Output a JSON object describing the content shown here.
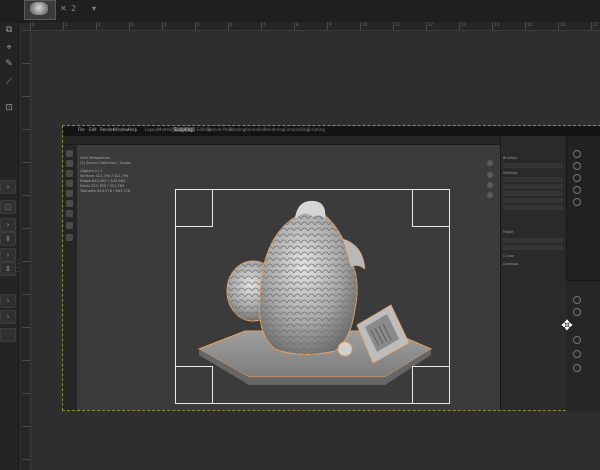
{
  "app": {
    "tab_indicator": "2",
    "accent_selection": "#e8a060",
    "layer_border_color": "#8c8c3c"
  },
  "rulers": {
    "horizontal_ticks": [
      "0",
      "1",
      "2",
      "3",
      "4",
      "5",
      "6",
      "7",
      "8",
      "9",
      "10",
      "11",
      "12",
      "13",
      "14",
      "15",
      "16",
      "17"
    ]
  },
  "toolbox": {
    "tool_icons": [
      "crop-icon",
      "eyedropper-icon",
      "brush-icon",
      "clone-icon",
      "transform-icon"
    ]
  },
  "blender": {
    "menus": [
      "File",
      "Edit",
      "Render",
      "Window",
      "Help"
    ],
    "workspaces": [
      "Layout",
      "Modeling",
      "Sculpting",
      "UV Editing",
      "Texture Paint",
      "Shading",
      "Animation",
      "Rendering",
      "Compositing",
      "Scripting"
    ],
    "active_workspace": "Sculpting",
    "viewport_info": [
      "User Perspective",
      "(1) Scene Collection | Sculpt"
    ],
    "stats": [
      "Objects    0 / 1",
      "Vertices   321,794 / 321,794",
      "Edges      643,582 / 643,582",
      "Faces      321,789 / 321,789",
      "Triangles  643,578 / 643,578"
    ],
    "props_sections": [
      "Brushes",
      "Settings",
      "Falloff",
      "Cursor",
      "Dyntopo",
      "Remesh",
      "Symmetry",
      "Options",
      "Workspace"
    ],
    "props_fields": [
      "Radius",
      "Strength",
      "Normal Radius",
      "Hardness",
      "Spacing"
    ]
  }
}
